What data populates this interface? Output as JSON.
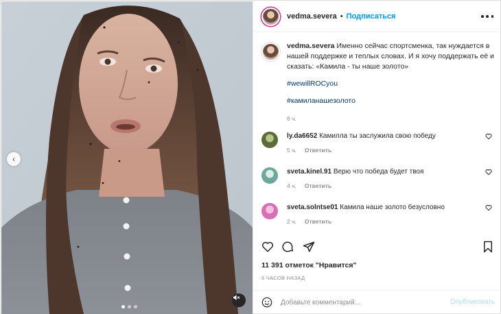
{
  "post": {
    "author": "vedma.severa",
    "follow_label": "Подписаться",
    "separator": "•",
    "caption": "Именно сейчас спортсменка, так нуждается в нашей поддержке и теплых словах. И я хочу поддержать её и сказать: «Камила - ты наше золото»",
    "hashtags": [
      "#wewillROCyou",
      "#камиланашезолото"
    ],
    "caption_time": "6 ч.",
    "likes_text": "11 391 отметок \"Нравится\"",
    "posted_time": "6 ЧАСОВ НАЗАД",
    "media": {
      "carousel_dots": 3,
      "active_dot": 1,
      "sound": "muted"
    }
  },
  "comments": [
    {
      "user": "ly.da6652",
      "text": "Камилла ты заслужила свою победу",
      "time": "5 ч.",
      "reply_label": "Ответить",
      "avatar_color": "#5b6b3a"
    },
    {
      "user": "sveta.kinel.91",
      "text": "Верю что победа будет твоя",
      "time": "4 ч.",
      "reply_label": "Ответить",
      "avatar_color": "#6fa89a"
    },
    {
      "user": "sveta.solntse01",
      "text": "Камила наше золото безусловно",
      "time": "2 ч.",
      "reply_label": "Ответить",
      "avatar_color": "#d86fb5"
    }
  ],
  "add_comment": {
    "placeholder": "Добавьте комментарий...",
    "publish_label": "Опубликовать"
  },
  "icons": {
    "more": "more-horizontal-icon",
    "like": "heart-icon",
    "comment": "comment-icon",
    "share": "send-icon",
    "save": "bookmark-icon",
    "emoji": "emoji-icon",
    "prev": "chevron-left-icon",
    "mute": "sound-off-icon"
  },
  "colors": {
    "link": "#0095f6",
    "hashtag": "#00376b",
    "muted_text": "#8e8e8e",
    "text": "#262626",
    "publish_disabled": "#b2dffc"
  }
}
